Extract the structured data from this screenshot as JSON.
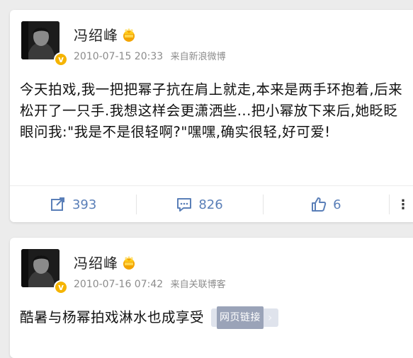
{
  "posts": [
    {
      "author": "冯绍峰",
      "time": "2010-07-15 20:33",
      "source": "来自新浪微博",
      "text": "今天拍戏,我一把把幂子抗在肩上就走,本来是两手环抱着,后来松开了一只手.我想这样会更潇洒些...把小幂放下来后,她眨眨眼问我:\"我是不是很轻啊?\"嘿嘿,确实很轻,好可爱!",
      "actions": {
        "repost_icon": "share-icon",
        "repost_count": "393",
        "comment_icon": "comment-icon",
        "comment_count": "826",
        "like_icon": "thumb-up-icon",
        "like_count": "6",
        "more_label": "⋮"
      }
    },
    {
      "author": "冯绍峰",
      "time": "2010-07-16 07:42",
      "source": "来自关联博客",
      "text": "酷暑与杨幂拍戏淋水也成享受",
      "link_label": "网页链接",
      "link_chevron": "›"
    }
  ],
  "colors": {
    "accent": "#5a7fb8",
    "verified": "#f5b400",
    "meta": "#8c8c8c"
  }
}
